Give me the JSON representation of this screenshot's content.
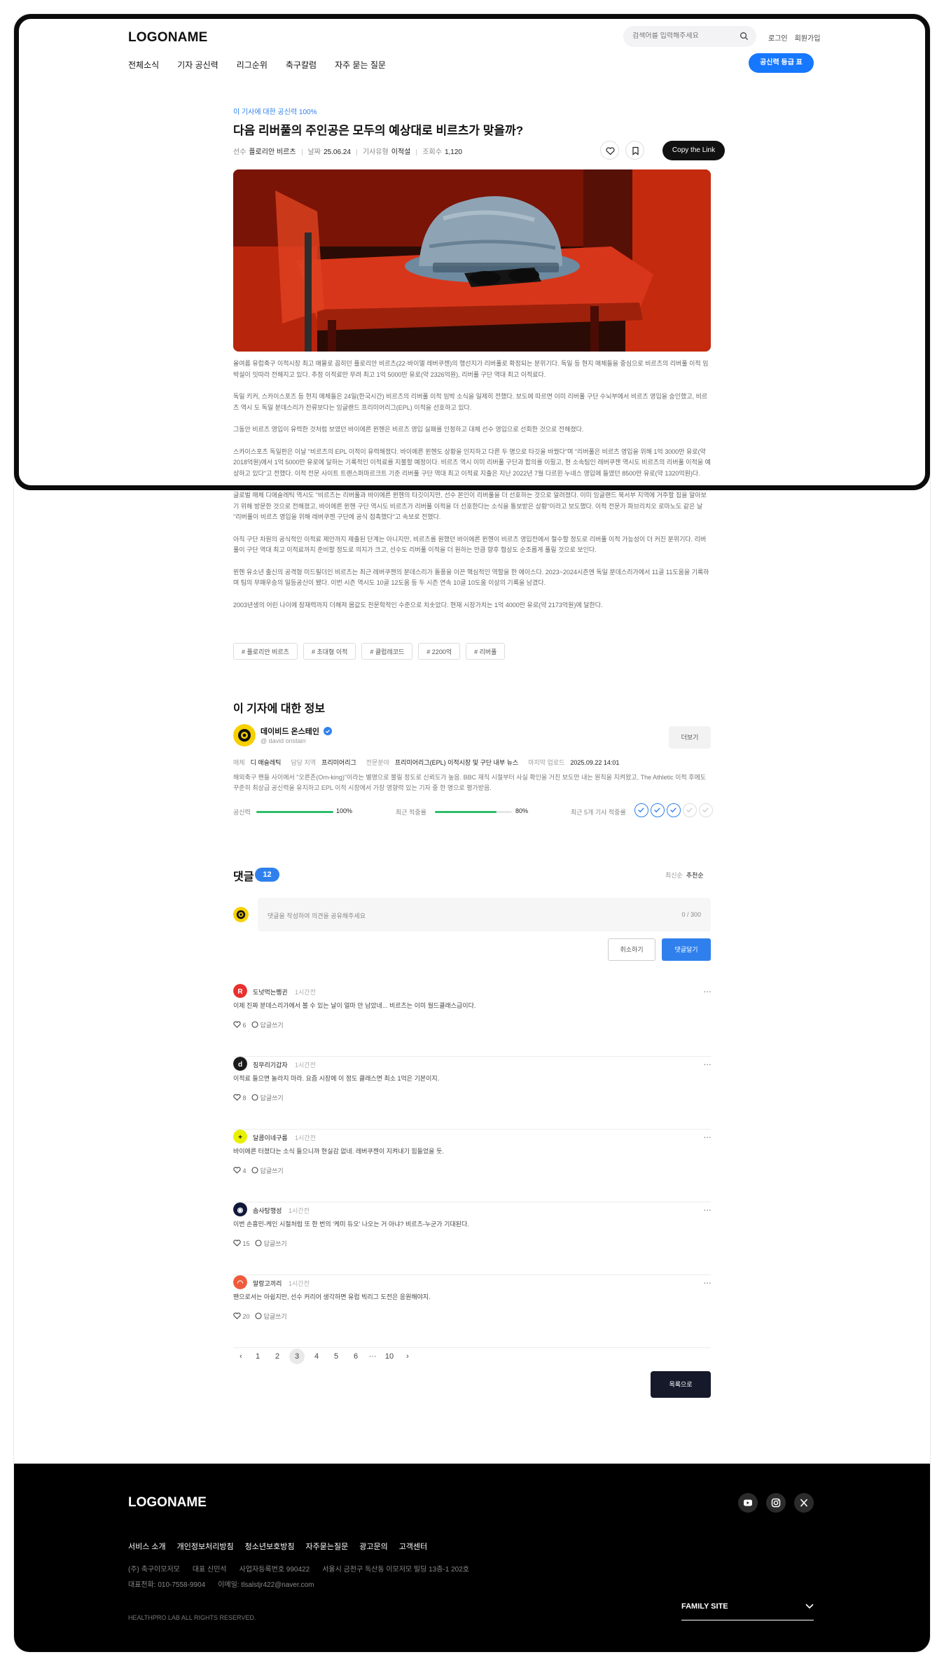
{
  "header": {
    "logo": "LOGONAME",
    "search_placeholder": "검색어를 입력해주세요",
    "login": "로그인",
    "signup": "회원가입",
    "nav": [
      "전체소식",
      "기자 공신력",
      "리그순위",
      "축구칼럼",
      "자주 묻는 질문"
    ],
    "cta": "공신력 등급 표"
  },
  "article": {
    "kicker": "이 기사에 대한 공신력 100%",
    "title": "다음 리버풀의 주인공은 모두의 예상대로 비르츠가 맞을까?",
    "meta": {
      "player_label": "선수",
      "player": "플로리안 비르츠",
      "date_label": "날짜",
      "date": "25.06.24",
      "type_label": "기사유형",
      "type": "이적설",
      "views_label": "조회수",
      "views": "1,120"
    },
    "copy_link": "Copy the Link",
    "paragraphs": [
      "올여름 유럽축구 이적시장 최고 매물로 꼽히던 플로리안 비르츠(22·바이엘 레버쿠젠)의 행선지가 리버풀로 확정되는 분위기다. 독일 등 현지 매체들을 중심으로 비르츠의 리버풀 이적 임박설이 잇따라 전해지고 있다. 추정 이적료만 무려 최고 1억 5000만 유로(약 2326억원), 리버풀 구단 역대 최고 이적료다.",
      "독일 키커, 스카이스포츠 등 현지 매체들은 24일(한국시간) 비르츠의 리버풀 이적 임박 소식을 일제히 전했다. 보도에 따르면 이미 리버풀 구단 수뇌부에서 비르츠 영입을 승인했고, 비르츠 역시 도 독일 분데스리가 잔류보다는 잉글랜드 프리미어리그(EPL) 이적을 선호하고 있다.",
      "그동안 비르츠 영입이 유력한 것처럼 보였던 바이에른 뮌헨은 비르츠 영입 실패를 인정하고 대체 선수 영입으로 선회한 것으로 전해졌다.",
      "스카이스포츠 독일판은 이날 \"비르츠의 EPL 이적이 유력해졌다. 바이에른 뮌헨도 상황을 인지하고 다른 두 명으로 타깃을 바꿨다\"며 \"리버풀은 비르츠 영입을 위해 1억 3000만 유로(약 2018억원)에서 1억 5000만 유로에 달하는 기록적인 이적료를 지불할 예정이다. 비르츠 역시 이미 리버풀 구단과 합의를 이뤘고, 현 소속팀인 레버쿠젠 역시도 비르츠의 리버풀 이적을 예상하고 있다\"고 전했다. 이적 전문 사이트 트랜스퍼마르크트 기준 리버풀 구단 역대 최고 이적료 지출은 지난 2022년 7월 다르윈 누녜스 영입에 들였던 8500만 유로(약 1320억원)다.",
      "글로벌 매체 디애슬레틱 역시도 \"비르츠는 리버풀과 바이에른 뮌헨의 타깃이지만, 선수 본인이 리버풀을 더 선호하는 것으로 알려졌다. 이미 잉글랜드 북서부 지역에 거주할 집을 알아보기 위해 방문한 것으로 전해졌고, 바이에른 뮌헨 구단 역시도 비르츠가 리버풀 이적을 더 선호한다는 소식을 통보받은 상황\"이라고 보도했다. 이적 전문가 파브리치오 로마노도 같은 날 \"리버풀이 비르츠 영입을 위해 레버쿠젠 구단에 공식 접촉했다\"고 속보로 전했다.",
      "아직 구단 차원의 공식적인 이적료 제안까지 제출된 단계는 아니지만, 비르츠를 원했던 바이에른 뮌헨이 비르츠 영입전에서 철수할 정도로 리버풀 이적 가능성이 더 커진 분위기다. 리버풀이 구단 역대 최고 이적료까지 준비할 정도로 의지가 크고, 선수도 리버풀 이적을 더 원하는 만큼 향후 협상도 순조롭게 풀릴 것으로 보인다.",
      "뮌헨 유소년 출신의 공격형 미드필더인 비르츠는 최근 레버쿠젠의 분데스리가 돌풍을 이끈 핵심적인 역할을 한 에이스다. 2023~2024시즌엔 독일 분데스리가에서 11골 11도움을 기록하며 팀의 무패우승의 일등공신이 됐다. 이번 시즌 역시도 10골 12도움 등 두 시즌 연속 10골 10도움 이상의 기록을 남겼다.",
      "2003년생의 어린 나이에 잠재력까지 더해져 몸값도 천문학적인 수준으로 치솟았다. 현재 시장가치는 1억 4000만 유로(약 2173억원)에 달한다."
    ],
    "tags": [
      "# 플로리안 비르츠",
      "# 초대형 이적",
      "# 클럽레코드",
      "# 2200억",
      "# 리버풀"
    ]
  },
  "reporter": {
    "heading": "이 기자에 대한 정보",
    "name": "데이비드 온스테인",
    "handle": "@ david onstain",
    "more": "더보기",
    "meta": {
      "media_label": "매체",
      "media": "디 애슬레틱",
      "area_label": "담당 지역",
      "area": "프리미어리그",
      "field_label": "전문분야",
      "field": "프리미어리그(EPL) 이적시장 및 구단 내부 뉴스",
      "upload_label": "마지막 업로드",
      "upload": "2025.09.22 14:01"
    },
    "description": "해외축구 팬들 사이에서 \"오른존(Orn-king)\"이라는 별명으로 불릴 정도로 신뢰도가 높음. BBC 재직 시절부터 사실 확인을 거친 보도만 내는 원칙을 지켜왔고, The Athletic 이적 후에도 꾸준히 최상급 공신력을 유지하고 EPL 이적 시장에서 가장 영향력 있는 기자 중 한 명으로 평가받음.",
    "credibility_label": "공신력",
    "credibility_value": "100%",
    "credibility_level": 100,
    "accuracy_label": "최근 적중률",
    "accuracy_value": "80%",
    "accuracy_level": 80,
    "recent_label": "최근 5개 기사 적중률",
    "recent_hits": [
      true,
      true,
      true,
      false,
      false
    ]
  },
  "comments": {
    "heading": "댓글",
    "count": "12",
    "sort_latest": "최신순",
    "sort_recommended": "추천순",
    "input_placeholder": "댓글을 작성하여 의견을 공유해주세요",
    "char_count": "0 / 300",
    "cancel": "취소하기",
    "submit": "댓글달기",
    "items": [
      {
        "name": "도넛먹는펭귄",
        "time": "1시간전",
        "text": "이제 진짜 분데스리가에서 볼 수 있는 날이 얼마 안 남았네... 비르츠는 이미 월드클래스급이다.",
        "likes": "6",
        "reply": "답글쓰기"
      },
      {
        "name": "징무리기갑자",
        "time": "1시간전",
        "text": "이적료 들으면 놀라지 마라. 요즘 시장에 이 정도 클래스면 최소 1억은 기본이지.",
        "likes": "8",
        "reply": "답글쓰기"
      },
      {
        "name": "달콤이네구름",
        "time": "1시간전",
        "text": "바이에른 터졌다는 소식 들으니까 현실감 없네. 레버쿠젠이 지켜내기 힘들었을 듯.",
        "likes": "4",
        "reply": "답글쓰기"
      },
      {
        "name": "솜사탕행성",
        "time": "1시간전",
        "text": "이번 손흥민-케인 시절처럼 또 한 번의 '케미 듀오' 나오는 거 아냐? 비르츠-누군가 기대된다.",
        "likes": "15",
        "reply": "답글쓰기"
      },
      {
        "name": "말랑고끼리",
        "time": "1시간전",
        "text": "팬으로서는 아쉽지만, 선수 커리어 생각하면 유럽 빅리그 도전은 응원해야지.",
        "likes": "20",
        "reply": "답글쓰기"
      }
    ],
    "pages": [
      "1",
      "2",
      "3",
      "4",
      "5",
      "6",
      "···",
      "10"
    ],
    "current_page": "3",
    "list_button": "목록으로"
  },
  "footer": {
    "logo": "LOGONAME",
    "links": [
      "서비스 소개",
      "개인정보처리방침",
      "청소년보호방침",
      "자주묻는질문",
      "광고문의",
      "고객센터"
    ],
    "info1": [
      "(주) 축구이모저모",
      "대표 신민석",
      "사업자등록번호 990422",
      "서울시 금천구 독산동 이모저모 빌딩 13층-1 202호"
    ],
    "info2": [
      "대표전화: 010-7558-9904",
      "이메일: tlsalstjr422@naver.com"
    ],
    "copyright": "HEALTHPRO LAB ALL RIGHTS RESERVED.",
    "family_site": "FAMILY SITE"
  }
}
